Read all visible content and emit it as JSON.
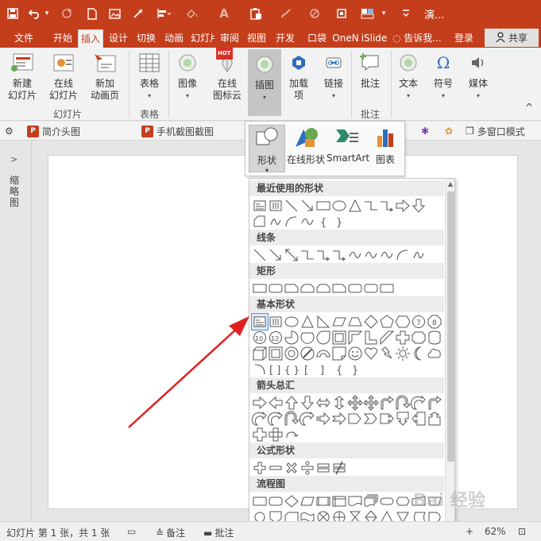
{
  "window": {
    "title": "演...",
    "icons": [
      "save-icon",
      "undo-icon",
      "undo-dropdown-icon",
      "redo-icon",
      "new-doc-icon",
      "image-icon",
      "eyedropper-icon",
      "align-icon",
      "fill-icon",
      "font-icon",
      "paste-icon",
      "brush-icon",
      "nosign-icon",
      "crop-icon",
      "layout-icon"
    ]
  },
  "tabs": [
    {
      "label": "文件"
    },
    {
      "label": "开始"
    },
    {
      "label": "插入",
      "active": true
    },
    {
      "label": "设计"
    },
    {
      "label": "切换"
    },
    {
      "label": "动画"
    },
    {
      "label": "幻灯片"
    },
    {
      "label": "审阅"
    },
    {
      "label": "视图"
    },
    {
      "label": "开发"
    },
    {
      "label": "口袋"
    },
    {
      "label": "OneN"
    },
    {
      "label": "iSlide"
    }
  ],
  "tell_me": "告诉我...",
  "login": "登录",
  "share": "共享",
  "ribbon": {
    "new_slide": "新建\n幻灯片",
    "online_slide": "在线\n幻灯片",
    "new_anim_page": "新加\n动画页",
    "table": "表格",
    "image": "图像",
    "online_icon": "在线\n图标云",
    "illustration": "插图",
    "addin": "加载\n项",
    "link": "链接",
    "comment": "批注",
    "text": "文本",
    "symbol": "符号",
    "media": "媒体",
    "hot_badge": "HOT",
    "groups": {
      "slides": "幻灯片",
      "table": "表格",
      "comment": "批注"
    }
  },
  "quickbar": {
    "item1": "简介头图",
    "item2": "手机截图截图",
    "multiwindow": "多窗口模式"
  },
  "thumbnail_pane_label": "缩略图",
  "illustration_menu": {
    "shape": "形状",
    "online_shape": "在线形状",
    "smartart": "SmartArt",
    "chart": "图表"
  },
  "gallery": {
    "recent": "最近使用的形状",
    "lines": "线条",
    "rect": "矩形",
    "basic": "基本形状",
    "arrows": "箭头总汇",
    "equation": "公式形状",
    "flowchart": "流程图"
  },
  "status": {
    "slide_info": "幻灯片 第 1 张，共 1 张",
    "notes": "备注",
    "comments": "批注",
    "zoom": "62%"
  },
  "watermark": "Bai 经验"
}
